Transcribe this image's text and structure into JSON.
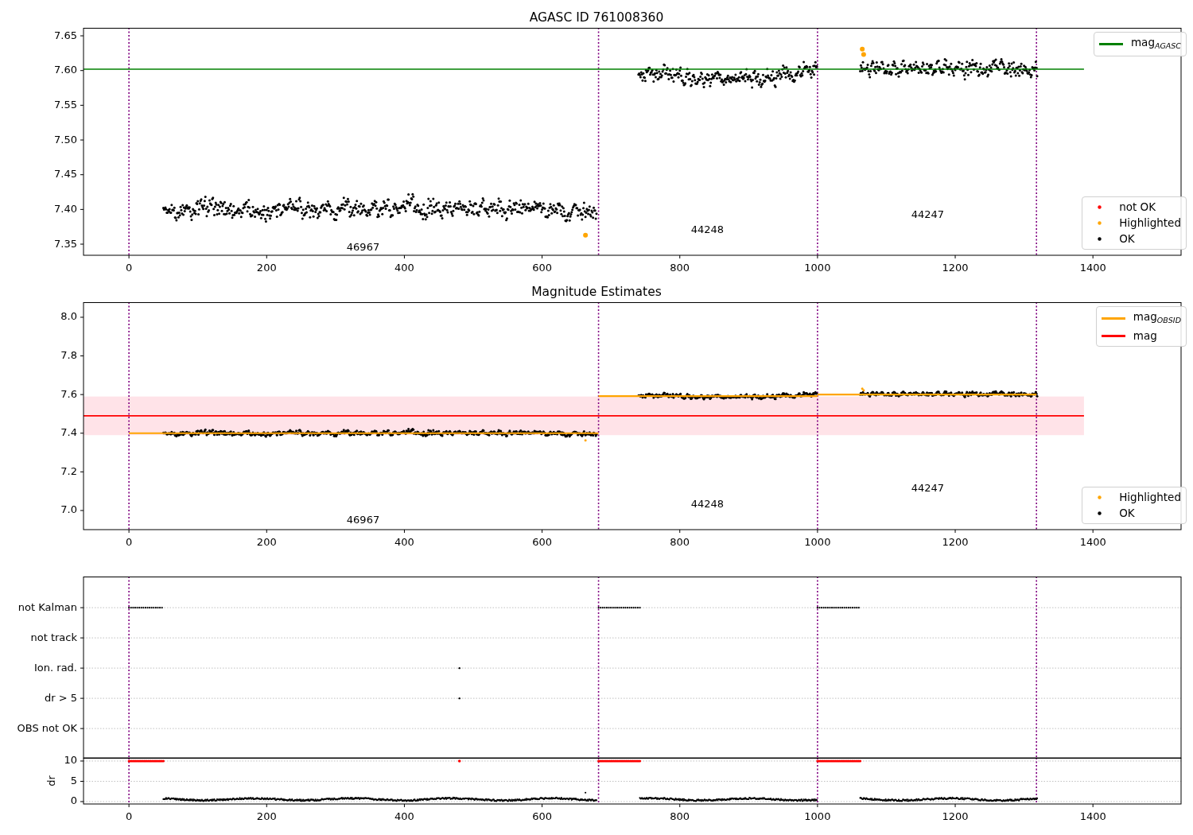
{
  "panels": [
    {
      "kind": "magnitude",
      "chart_data": {
        "type": "scatter",
        "title": "AGASC ID 761008360",
        "xlim": [
          -66,
          1528
        ],
        "ylim": [
          7.334,
          7.6615
        ],
        "xticks": [
          0,
          200,
          400,
          600,
          800,
          1000,
          1200,
          1400
        ],
        "yticks": [
          {
            "value": 7.35,
            "label": "7.35"
          },
          {
            "value": 7.4,
            "label": "7.40"
          },
          {
            "value": 7.45,
            "label": "7.45"
          },
          {
            "value": 7.5,
            "label": "7.50"
          },
          {
            "value": 7.55,
            "label": "7.55"
          },
          {
            "value": 7.6,
            "label": "7.60"
          },
          {
            "value": 7.65,
            "label": "7.65"
          }
        ],
        "x": [
          663,
          1065,
          1067
        ],
        "series": [
          {
            "name": "not OK",
            "color": "#ff0000",
            "values": [
              null,
              null,
              null
            ]
          },
          {
            "name": "Highlighted",
            "color": "#ffa500",
            "values": [
              7.363,
              7.631,
              7.623
            ]
          },
          {
            "name": "OK",
            "color": "#000000",
            "values": [
              null,
              null,
              null
            ]
          }
        ],
        "ref_lines": [
          {
            "axis": "y",
            "value": 7.602,
            "label": "mag$_{AGASC}$",
            "color": "#008000"
          },
          {
            "axis": "x",
            "value": 0,
            "color": "#800080"
          },
          {
            "axis": "x",
            "value": 682,
            "color": "#800080"
          },
          {
            "axis": "x",
            "value": 1000,
            "color": "#800080"
          },
          {
            "axis": "x",
            "value": 1318,
            "color": "#800080"
          }
        ],
        "annotations": [
          "46967",
          "44248",
          "44247"
        ]
      }
    },
    {
      "kind": "magnitude",
      "legend": [
        {
          "label": "Highlighted",
          "color": "#ffa500"
        },
        {
          "label": "OK",
          "color": "#000000"
        }
      ],
      "chart_data": {
        "type": "line",
        "title": "Magnitude Estimates",
        "xlim": [
          -66,
          1528
        ],
        "ylim": [
          6.901,
          8.078
        ],
        "xticks": [
          0,
          200,
          400,
          600,
          800,
          1000,
          1200,
          1400
        ],
        "yticks": [
          {
            "value": 7.0,
            "label": "7.0"
          },
          {
            "value": 7.2,
            "label": "7.2"
          },
          {
            "value": 7.4,
            "label": "7.4"
          },
          {
            "value": 7.6,
            "label": "7.6"
          },
          {
            "value": 7.8,
            "label": "7.8"
          },
          {
            "value": 8.0,
            "label": "8.0"
          }
        ],
        "x": [
          0,
          682,
          682,
          1000,
          1000,
          1318
        ],
        "series": [
          {
            "name": "mag$_{OBSID}$",
            "color": "#ffa500",
            "values": [
              7.4,
              7.4,
              7.592,
              7.592,
              7.6,
              7.6
            ]
          }
        ],
        "ref_lines": [
          {
            "axis": "y",
            "value": 7.49,
            "label": "mag",
            "color": "#ff0000"
          },
          {
            "axis": "x",
            "value": 0,
            "color": "#800080"
          },
          {
            "axis": "x",
            "value": 682,
            "color": "#800080"
          },
          {
            "axis": "x",
            "value": 1000,
            "color": "#800080"
          },
          {
            "axis": "x",
            "value": 1318,
            "color": "#800080"
          }
        ],
        "bands": [
          {
            "axis": "y",
            "from": 7.39,
            "to": 7.59,
            "color": "#ffc0cb"
          }
        ],
        "annotations": [
          "46967",
          "44248",
          "44247"
        ]
      }
    },
    {
      "kind": "flags",
      "rows": [
        "not Kalman",
        "not track",
        "Ion. rad.",
        "dr > 5",
        "OBS not OK"
      ]
    },
    {
      "kind": "dr",
      "chart_data": {
        "type": "scatter",
        "ylabel": "dr",
        "grid": true,
        "xlim": [
          -66,
          1528
        ],
        "ylim": [
          -0.59,
          10.78
        ],
        "xticks": [
          0,
          200,
          400,
          600,
          800,
          1000,
          1200,
          1400
        ],
        "yticks": [
          0,
          5,
          10
        ],
        "ref_lines": [
          {
            "axis": "x",
            "value": 0,
            "color": "#800080"
          },
          {
            "axis": "x",
            "value": 682,
            "color": "#800080"
          },
          {
            "axis": "x",
            "value": 1000,
            "color": "#800080"
          },
          {
            "axis": "x",
            "value": 1318,
            "color": "#800080"
          }
        ]
      }
    }
  ]
}
